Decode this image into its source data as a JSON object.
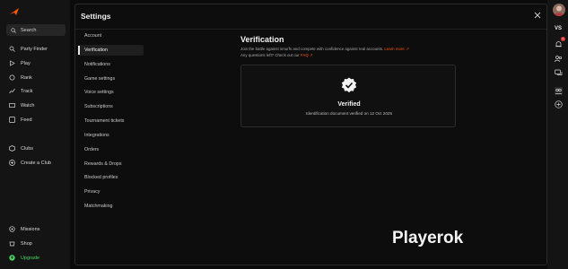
{
  "sidebar": {
    "search_label": "Search",
    "nav": [
      {
        "label": "Party Finder",
        "icon": "party-finder-icon"
      },
      {
        "label": "Play",
        "icon": "play-icon"
      },
      {
        "label": "Rank",
        "icon": "rank-icon"
      },
      {
        "label": "Track",
        "icon": "track-icon"
      },
      {
        "label": "Watch",
        "icon": "watch-icon"
      },
      {
        "label": "Feed",
        "icon": "feed-icon"
      },
      {
        "label": "Clubs",
        "icon": "clubs-icon"
      },
      {
        "label": "Create a Club",
        "icon": "plus-circle-icon"
      }
    ],
    "bottom": [
      {
        "label": "Missions",
        "icon": "missions-icon"
      },
      {
        "label": "Shop",
        "icon": "shop-icon"
      },
      {
        "label": "Upgrade",
        "icon": "upgrade-icon"
      }
    ]
  },
  "modal": {
    "title": "Settings",
    "menu": [
      "Account",
      "Verification",
      "Notifications",
      "Game settings",
      "Voice settings",
      "Subscriptions",
      "Tournament tickets",
      "Integrations",
      "Orders",
      "Rewards & Drops",
      "Blocked profiles",
      "Privacy",
      "Matchmaking"
    ],
    "active_item": "Verification"
  },
  "content": {
    "title": "Verification",
    "desc_line1": "Join the battle against smurfs and compete with confidence against real accounts.",
    "learn_more": "Learn more",
    "desc_line2": "Any questions left? Check out our",
    "faq": "FAQ",
    "status": "Verified",
    "detail": "Identification document verified on 12 Oct 2025"
  },
  "right_rail": {
    "vs_label": "VS",
    "notification_count": "1"
  },
  "watermark": "Playerok",
  "colors": {
    "accent": "#ff5500",
    "upgrade": "#41d35e",
    "notif": "#e53935"
  }
}
